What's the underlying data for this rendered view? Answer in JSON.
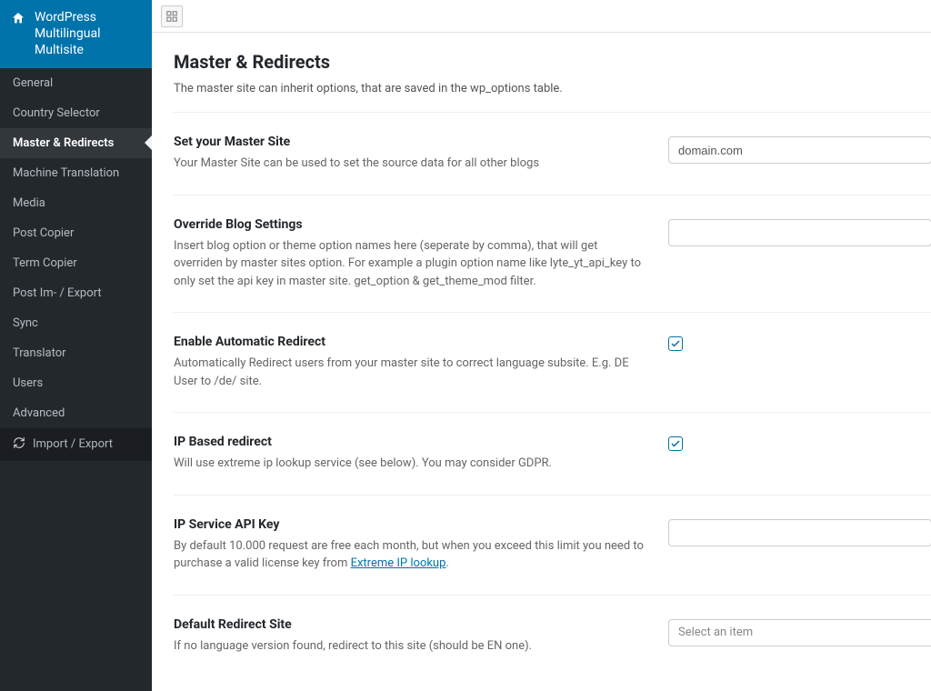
{
  "app_title": "WordPress Multilingual Multisite",
  "sidebar": {
    "items": [
      {
        "label": "General",
        "key": "general"
      },
      {
        "label": "Country Selector",
        "key": "country-selector"
      },
      {
        "label": "Master & Redirects",
        "key": "master-redirects",
        "active": true
      },
      {
        "label": "Machine Translation",
        "key": "machine-translation"
      },
      {
        "label": "Media",
        "key": "media"
      },
      {
        "label": "Post Copier",
        "key": "post-copier"
      },
      {
        "label": "Term Copier",
        "key": "term-copier"
      },
      {
        "label": "Post Im- / Export",
        "key": "post-im-export"
      },
      {
        "label": "Sync",
        "key": "sync"
      },
      {
        "label": "Translator",
        "key": "translator"
      },
      {
        "label": "Users",
        "key": "users"
      },
      {
        "label": "Advanced",
        "key": "advanced"
      }
    ],
    "import_export_label": "Import / Export"
  },
  "page": {
    "title": "Master & Redirects",
    "description": "The master site can inherit options, that are saved in the wp_options table."
  },
  "fields": {
    "master_site": {
      "title": "Set your Master Site",
      "desc": "Your Master Site can be used to set the source data for all other blogs",
      "value": "domain.com"
    },
    "override": {
      "title": "Override Blog Settings",
      "desc": "Insert blog option or theme option names here (seperate by comma), that will get overriden by master sites option. For example a plugin option name like lyte_yt_api_key to only set the api key in master site. get_option & get_theme_mod filter.",
      "value": ""
    },
    "auto_redirect": {
      "title": "Enable Automatic Redirect",
      "desc": "Automatically Redirect users from your master site to correct language subsite. E.g. DE User to /de/ site.",
      "checked": true
    },
    "ip_redirect": {
      "title": "IP Based redirect",
      "desc": "Will use extreme ip lookup service (see below). You may consider GDPR.",
      "checked": true
    },
    "ip_api": {
      "title": "IP Service API Key",
      "desc_pre": "By default 10.000 request are free each month, but when you exceed this limit you need to purchase a valid license key from ",
      "link_text": "Extreme IP lookup",
      "desc_post": ".",
      "value": ""
    },
    "default_redirect": {
      "title": "Default Redirect Site",
      "desc": "If no language version found, redirect to this site (should be EN one).",
      "placeholder": "Select an item"
    }
  }
}
